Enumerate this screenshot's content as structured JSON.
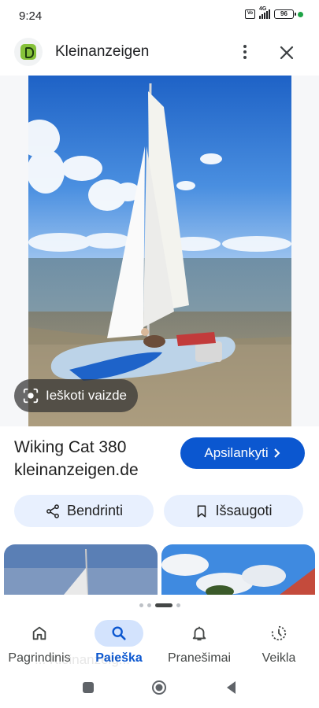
{
  "status_bar": {
    "time": "9:24",
    "sim_label": "VoLTE",
    "network": "4G",
    "battery": "96"
  },
  "header": {
    "title": "Kleinanzeigen"
  },
  "image": {
    "lens_label": "Ieškoti vaizde"
  },
  "result": {
    "title": "Wiking Cat 380",
    "domain": "kleinanzeigen.de",
    "visit_label": "Apsilankyti"
  },
  "actions": {
    "share_label": "Bendrinti",
    "save_label": "Išsaugoti"
  },
  "nav": {
    "items": [
      {
        "label": "Pagrindinis",
        "icon": "home-icon"
      },
      {
        "label": "Paieška",
        "icon": "search-icon",
        "active": true
      },
      {
        "label": "Pranešimai",
        "icon": "bell-icon"
      },
      {
        "label": "Veikla",
        "icon": "activity-icon"
      }
    ],
    "ghost_text": "... Kleinanzeig..."
  },
  "colors": {
    "accent": "#0b57d0",
    "chip_bg": "#e8f0fe",
    "nav_active_bg": "#d3e3fd"
  }
}
